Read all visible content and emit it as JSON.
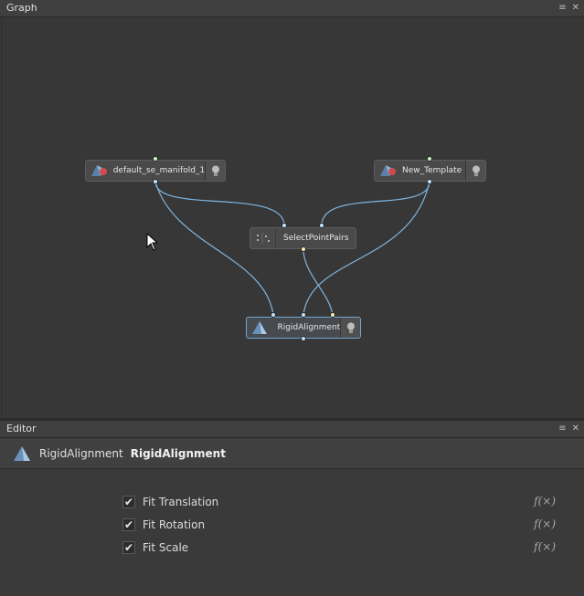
{
  "graph_panel": {
    "title": "Graph",
    "menu_icon": "≡",
    "close_icon": "✕"
  },
  "nodes": {
    "manifold": {
      "label": "default_se_manifold_1"
    },
    "template": {
      "label": "New_Template"
    },
    "select_pairs": {
      "label": "SelectPointPairs"
    },
    "rigid": {
      "label": "RigidAlignment"
    }
  },
  "editor_panel": {
    "title": "Editor",
    "menu_icon": "≡",
    "close_icon": "✕",
    "node_type": "RigidAlignment",
    "node_name": "RigidAlignment",
    "params": [
      {
        "label": "Fit Translation",
        "checked": true,
        "fx": "f(×)"
      },
      {
        "label": "Fit Rotation",
        "checked": true,
        "fx": "f(×)"
      },
      {
        "label": "Fit Scale",
        "checked": true,
        "fx": "f(×)"
      }
    ]
  },
  "colors": {
    "wire": "#7fb6e0",
    "selected_border": "#6fa6d6",
    "port_blue": "#bfe2ff",
    "port_green": "#c8f0c0",
    "port_yellow": "#f4efb0"
  }
}
